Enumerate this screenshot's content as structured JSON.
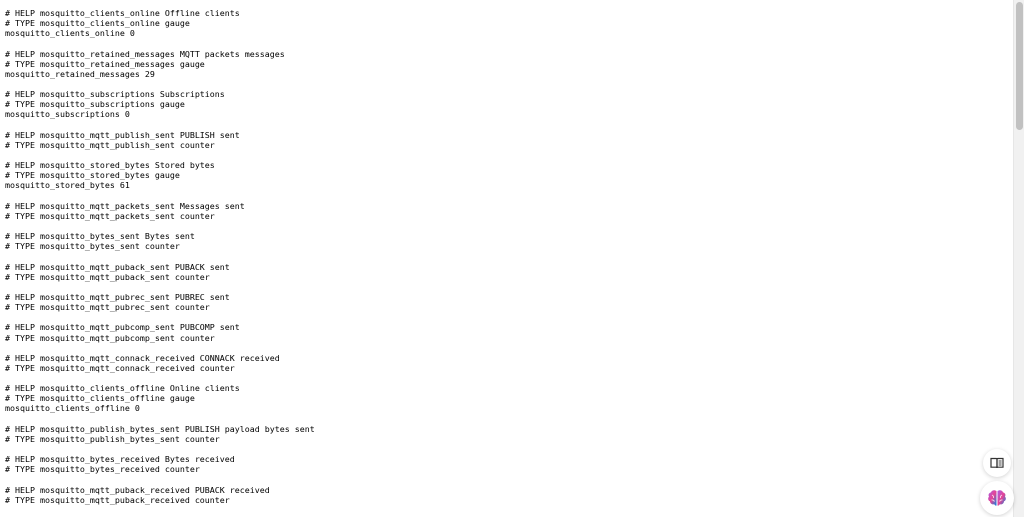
{
  "metrics_text": {
    "lines": [
      "# HELP mosquitto_clients_online Offline clients",
      "# TYPE mosquitto_clients_online gauge",
      "mosquitto_clients_online 0",
      "",
      "# HELP mosquitto_retained_messages MQTT packets messages",
      "# TYPE mosquitto_retained_messages gauge",
      "mosquitto_retained_messages 29",
      "",
      "# HELP mosquitto_subscriptions Subscriptions",
      "# TYPE mosquitto_subscriptions gauge",
      "mosquitto_subscriptions 0",
      "",
      "# HELP mosquitto_mqtt_publish_sent PUBLISH sent",
      "# TYPE mosquitto_mqtt_publish_sent counter",
      "",
      "# HELP mosquitto_stored_bytes Stored bytes",
      "# TYPE mosquitto_stored_bytes gauge",
      "mosquitto_stored_bytes 61",
      "",
      "# HELP mosquitto_mqtt_packets_sent Messages sent",
      "# TYPE mosquitto_mqtt_packets_sent counter",
      "",
      "# HELP mosquitto_bytes_sent Bytes sent",
      "# TYPE mosquitto_bytes_sent counter",
      "",
      "# HELP mosquitto_mqtt_puback_sent PUBACK sent",
      "# TYPE mosquitto_mqtt_puback_sent counter",
      "",
      "# HELP mosquitto_mqtt_pubrec_sent PUBREC sent",
      "# TYPE mosquitto_mqtt_pubrec_sent counter",
      "",
      "# HELP mosquitto_mqtt_pubcomp_sent PUBCOMP sent",
      "# TYPE mosquitto_mqtt_pubcomp_sent counter",
      "",
      "# HELP mosquitto_mqtt_connack_received CONNACK received",
      "# TYPE mosquitto_mqtt_connack_received counter",
      "",
      "# HELP mosquitto_clients_offline Online clients",
      "# TYPE mosquitto_clients_offline gauge",
      "mosquitto_clients_offline 0",
      "",
      "# HELP mosquitto_publish_bytes_sent PUBLISH payload bytes sent",
      "# TYPE mosquitto_publish_bytes_sent counter",
      "",
      "# HELP mosquitto_bytes_received Bytes received",
      "# TYPE mosquitto_bytes_received counter",
      "",
      "# HELP mosquitto_mqtt_puback_received PUBACK received",
      "# TYPE mosquitto_mqtt_puback_received counter"
    ]
  },
  "floating_buttons": {
    "reader": {
      "icon": "book-open-icon"
    },
    "assistant": {
      "icon": "brain-icon",
      "colors": [
        "#6c5ce7",
        "#e84393",
        "#0984e3"
      ]
    }
  }
}
